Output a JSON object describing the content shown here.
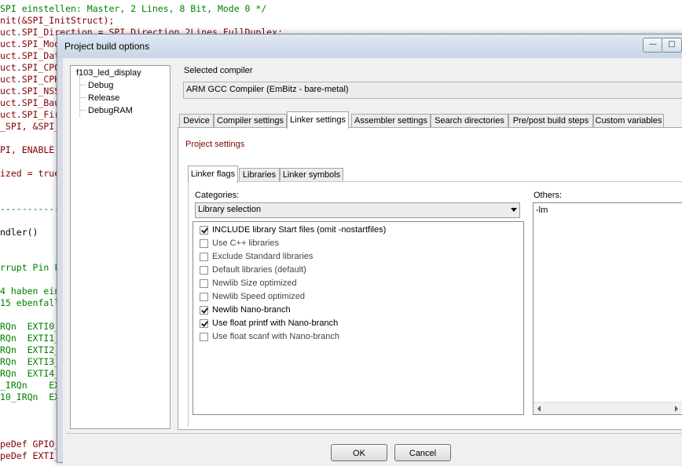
{
  "editor": {
    "lines": [
      {
        "text": "SPI einstellen: Master, 2 Lines, 8 Bit, Mode 0 */",
        "color": "#008000"
      },
      {
        "text": "nit(&SPI_InitStruct);",
        "color": "#800000"
      },
      {
        "text": "uct.SPI_Direction = SPI_Direction_2Lines_FullDuplex;",
        "color": "#800000"
      },
      {
        "text": "uct.SPI_Mod",
        "color": "#800000"
      },
      {
        "text": "uct.SPI_Dat",
        "color": "#800000"
      },
      {
        "text": "uct.SPI_CPO",
        "color": "#800000"
      },
      {
        "text": "uct.SPI_CPH",
        "color": "#800000"
      },
      {
        "text": "uct.SPI_NSS",
        "color": "#800000"
      },
      {
        "text": "uct.SPI_Bau",
        "color": "#800000"
      },
      {
        "text": "uct.SPI_Fir",
        "color": "#800000"
      },
      {
        "text": "_SPI, &SPI_",
        "color": "#800000"
      },
      {
        "text": "",
        "color": "#000000"
      },
      {
        "text": "PI, ENABLE",
        "color": "#800000"
      },
      {
        "text": "",
        "color": "#000000"
      },
      {
        "text": "ized = true",
        "color": "#800000"
      },
      {
        "text": "",
        "color": "#000000"
      },
      {
        "text": "",
        "color": "#000000"
      },
      {
        "text": "-----------",
        "color": "#008000"
      },
      {
        "text": "",
        "color": "#000000"
      },
      {
        "text": "ndler()",
        "color": "#000000"
      },
      {
        "text": "",
        "color": "#000000"
      },
      {
        "text": "",
        "color": "#000000"
      },
      {
        "text": "rrupt Pin k",
        "color": "#008000"
      },
      {
        "text": "",
        "color": "#000000"
      },
      {
        "text": "4 haben ein",
        "color": "#008000"
      },
      {
        "text": "15 ebenfall",
        "color": "#008000"
      },
      {
        "text": "",
        "color": "#000000"
      },
      {
        "text": "RQn  EXTI0_",
        "color": "#008000"
      },
      {
        "text": "RQn  EXTI1_",
        "color": "#008000"
      },
      {
        "text": "RQn  EXTI2_",
        "color": "#008000"
      },
      {
        "text": "RQn  EXTI3_",
        "color": "#008000"
      },
      {
        "text": "RQn  EXTI4_",
        "color": "#008000"
      },
      {
        "text": "_IRQn    EX",
        "color": "#008000"
      },
      {
        "text": "10_IRQn  EX",
        "color": "#008000"
      },
      {
        "text": "",
        "color": "#000000"
      },
      {
        "text": "",
        "color": "#000000"
      },
      {
        "text": "",
        "color": "#000000"
      },
      {
        "text": "peDef GPIO_",
        "color": "#800000"
      },
      {
        "text": "peDef EXTI_",
        "color": "#800000"
      }
    ]
  },
  "dialog": {
    "title": "Project build options",
    "title_buttons": [
      "—",
      "□"
    ],
    "tree": {
      "root": "f103_led_display",
      "children": [
        "Debug",
        "Release",
        "DebugRAM"
      ]
    },
    "selected_compiler_label": "Selected compiler",
    "selected_compiler_value": "ARM GCC Compiler (EmBitz - bare-metal)",
    "tabs": [
      "Device",
      "Compiler settings",
      "Linker settings",
      "Assembler settings",
      "Search directories",
      "Pre/post build steps",
      "Custom variables"
    ],
    "active_tab": "Linker settings",
    "project_settings_label": "Project settings",
    "subtabs": [
      "Linker flags",
      "Libraries",
      "Linker symbols"
    ],
    "active_subtab": "Linker flags",
    "categories_label": "Categories:",
    "categories_value": "Library selection",
    "options": [
      {
        "label": "INCLUDE library Start files (omit -nostartfiles)",
        "checked": true
      },
      {
        "label": "Use C++ libraries",
        "checked": false
      },
      {
        "label": "Exclude Standard libraries",
        "checked": false
      },
      {
        "label": "Default libraries (default)",
        "checked": false
      },
      {
        "label": "Newlib Size optimized",
        "checked": false
      },
      {
        "label": "Newlib Speed optimized",
        "checked": false
      },
      {
        "label": "Newlib Nano-branch",
        "checked": true
      },
      {
        "label": "Use float printf with Nano-branch",
        "checked": true
      },
      {
        "label": "Use float scanf  with Nano-branch",
        "checked": false
      }
    ],
    "others_label": "Others:",
    "others_value": "-lm",
    "ok_label": "OK",
    "cancel_label": "Cancel"
  },
  "colors": {
    "accent_red": "#800000",
    "comment_green": "#008000",
    "keyword_blue": "#0000ff"
  }
}
